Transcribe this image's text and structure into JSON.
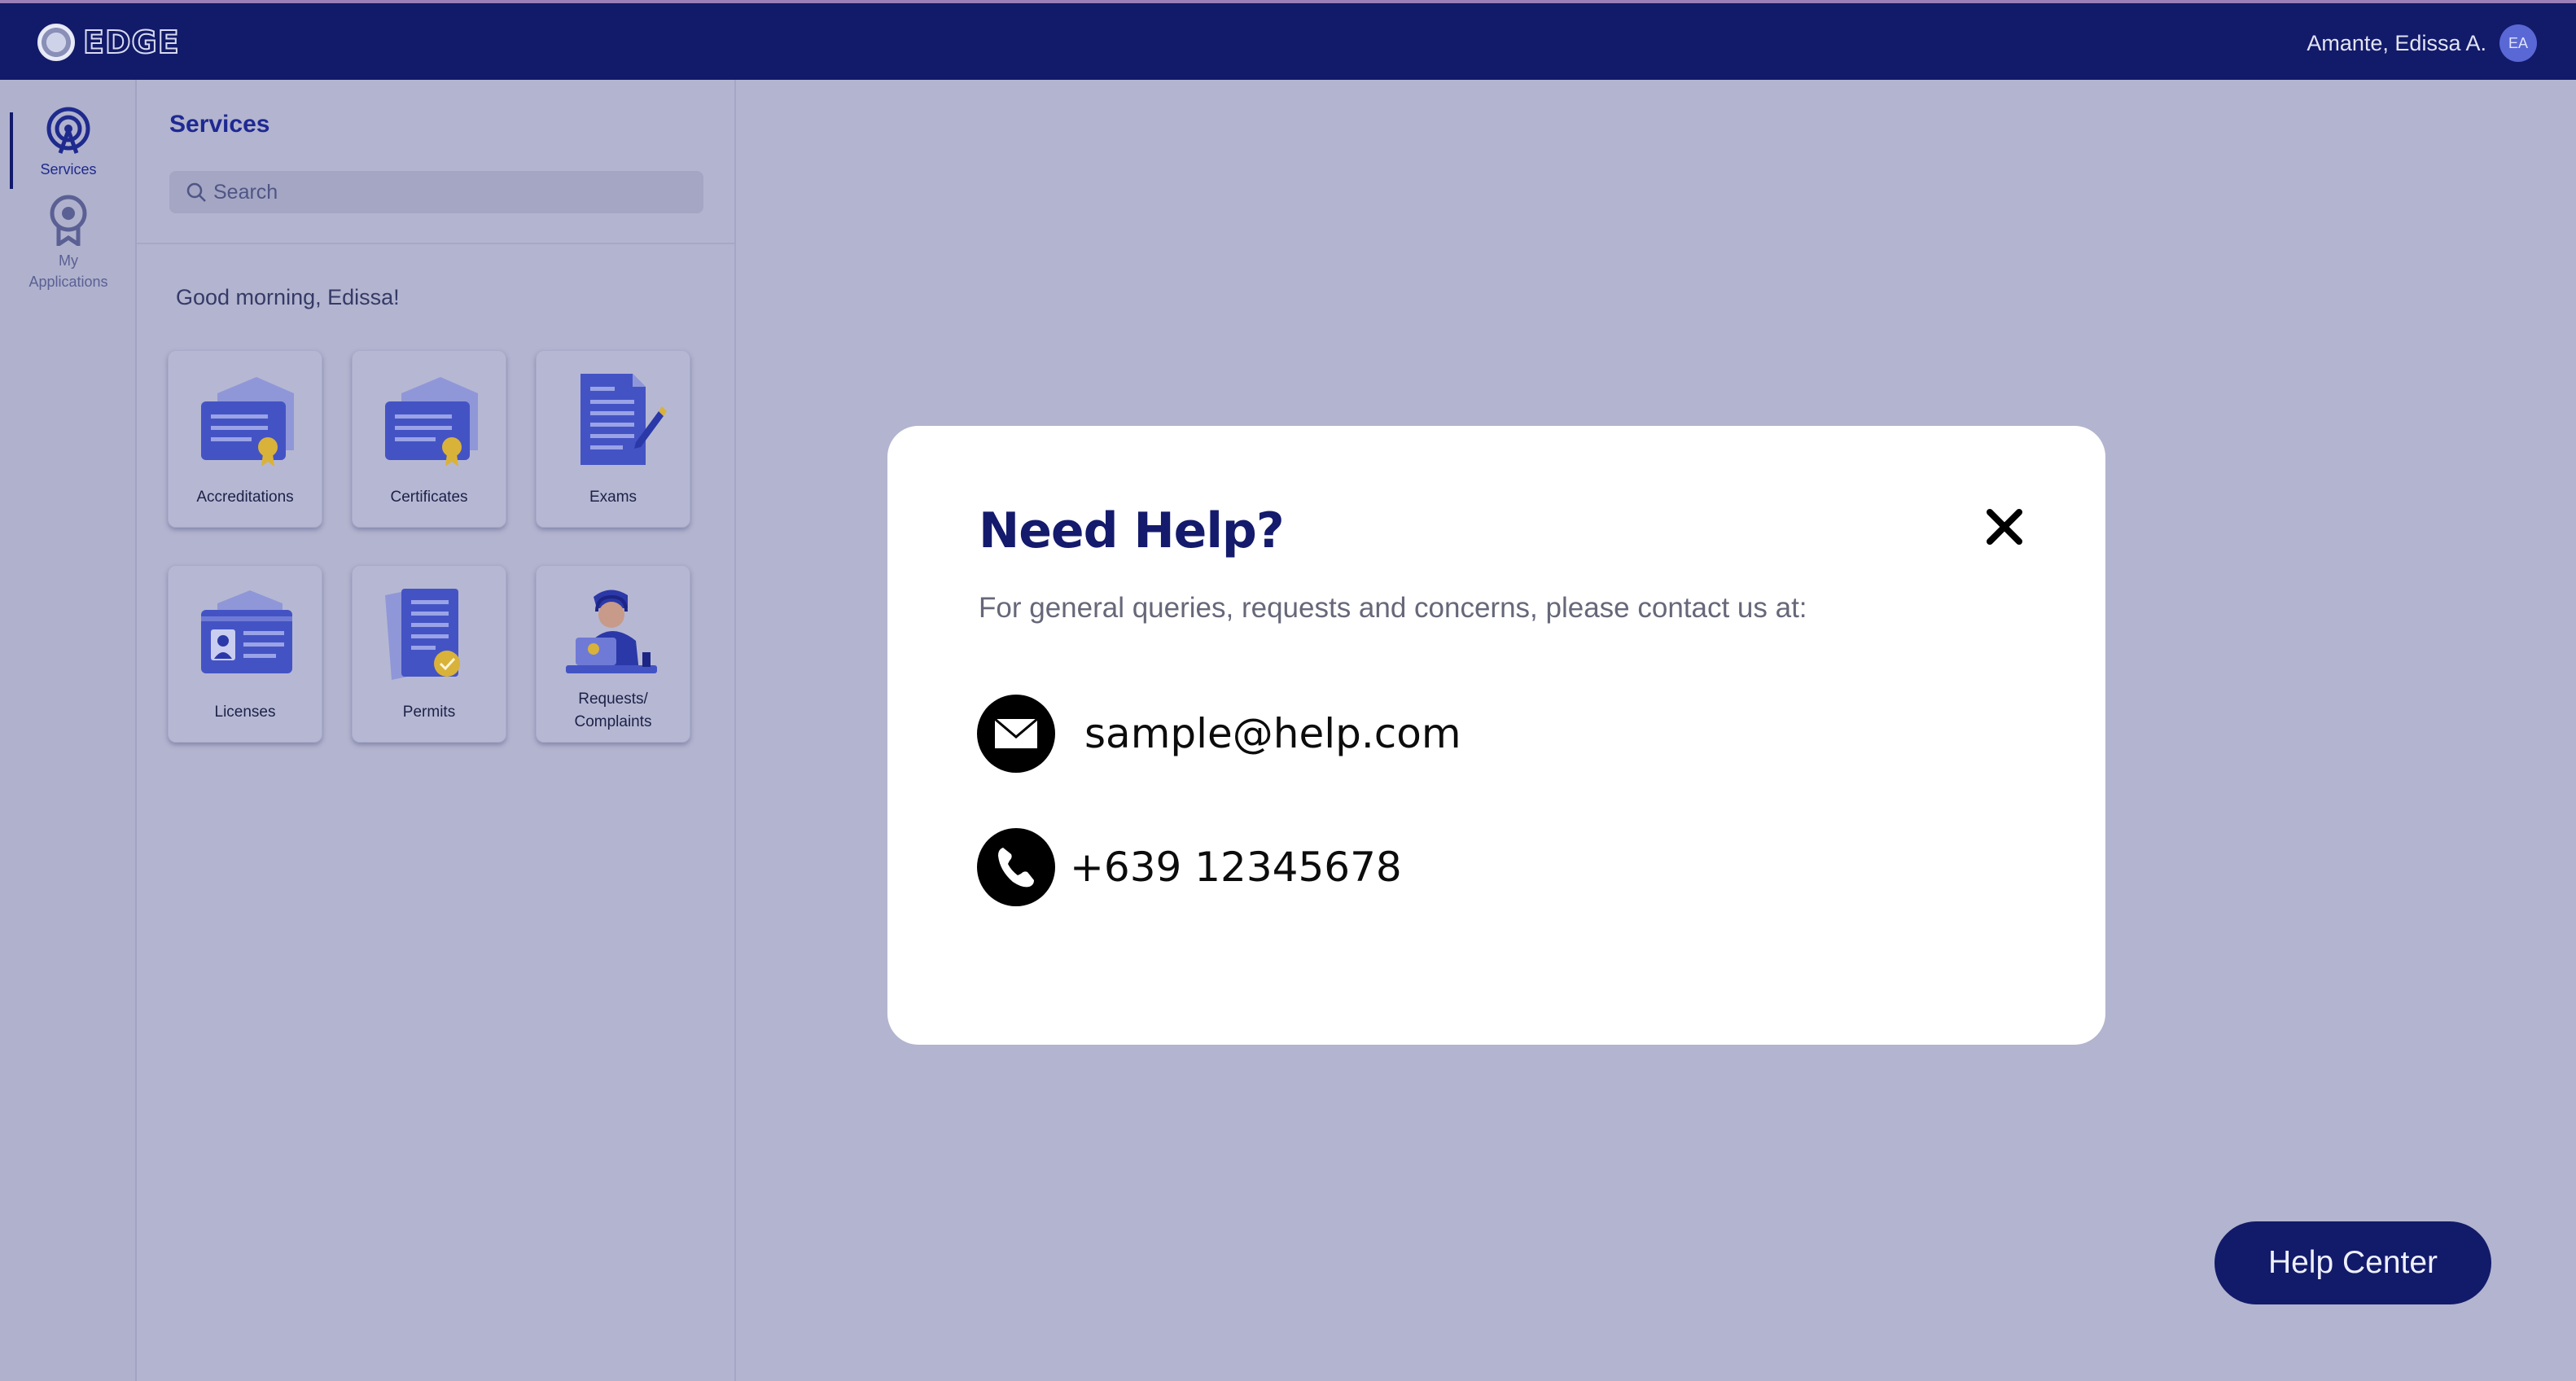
{
  "header": {
    "logo_text": "EDGE",
    "user_name": "Amante, Edissa A.",
    "user_initials": "EA"
  },
  "rail": {
    "items": [
      {
        "label": "Services",
        "active": true
      },
      {
        "label_line1": "My",
        "label_line2": "Applications",
        "active": false
      }
    ]
  },
  "panel": {
    "title": "Services",
    "search_placeholder": "Search",
    "greeting": "Good morning, Edissa!",
    "cards": [
      {
        "label": "Accreditations",
        "icon": "certificate-icon"
      },
      {
        "label": "Certificates",
        "icon": "certificate-icon"
      },
      {
        "label": "Exams",
        "icon": "exam-document-icon"
      },
      {
        "label": "Licenses",
        "icon": "license-card-icon"
      },
      {
        "label": "Permits",
        "icon": "permit-document-icon"
      },
      {
        "label_line1": "Requests/",
        "label_line2": "Complaints",
        "icon": "support-agent-icon"
      }
    ]
  },
  "modal": {
    "title": "Need Help?",
    "subtitle": "For general queries, requests and concerns, please contact us at:",
    "email": "sample@help.com",
    "phone": "+639 12345678",
    "close_icon": "close-icon"
  },
  "help_center": {
    "label": "Help Center"
  },
  "colors": {
    "navy": "#121a6a",
    "accent_blue": "#5a68d6",
    "overlay": "#b3b4cf"
  }
}
